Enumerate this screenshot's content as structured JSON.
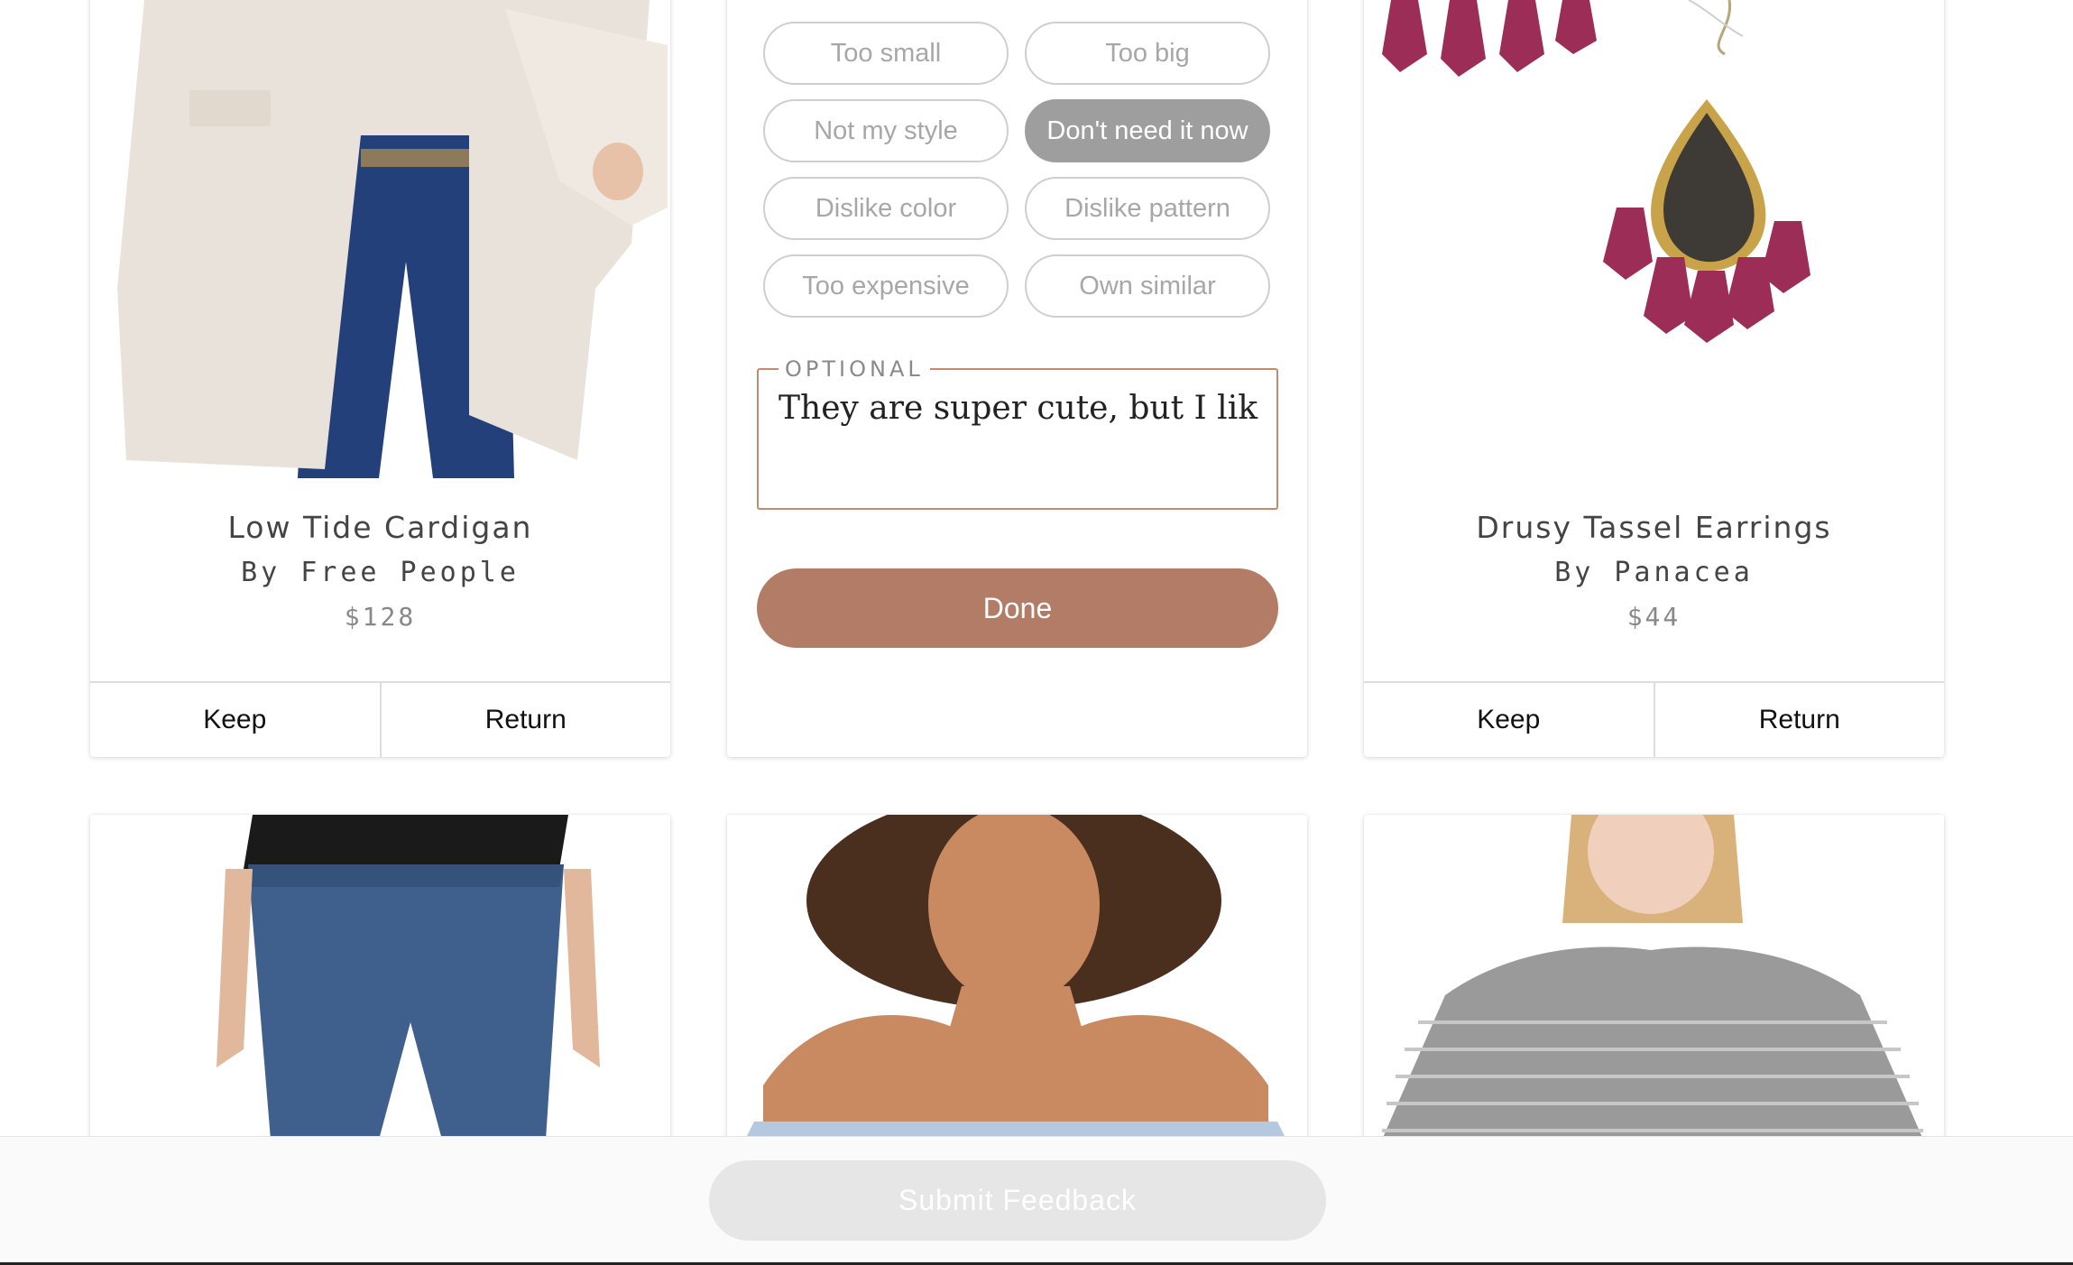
{
  "products": [
    {
      "title": "Low Tide Cardigan",
      "brand": "By Free People",
      "price": "$128",
      "keep_label": "Keep",
      "return_label": "Return"
    },
    {
      "title": "Drusy Tassel Earrings",
      "brand": "By Panacea",
      "price": "$44",
      "keep_label": "Keep",
      "return_label": "Return"
    }
  ],
  "feedback": {
    "reasons": [
      {
        "label": "Too small",
        "selected": false
      },
      {
        "label": "Too big",
        "selected": false
      },
      {
        "label": "Not my style",
        "selected": false
      },
      {
        "label": "Don't need it now",
        "selected": true
      },
      {
        "label": "Dislike color",
        "selected": false
      },
      {
        "label": "Dislike pattern",
        "selected": false
      },
      {
        "label": "Too expensive",
        "selected": false
      },
      {
        "label": "Own similar",
        "selected": false
      }
    ],
    "optional_legend": "OPTIONAL",
    "comment_value": "They are super cute, but I like t",
    "done_label": "Done"
  },
  "footer": {
    "submit_label": "Submit Feedback"
  },
  "colors": {
    "accent": "#b27c66",
    "chip_selected": "#9e9e9e",
    "submit_disabled": "#e6e6e6"
  }
}
